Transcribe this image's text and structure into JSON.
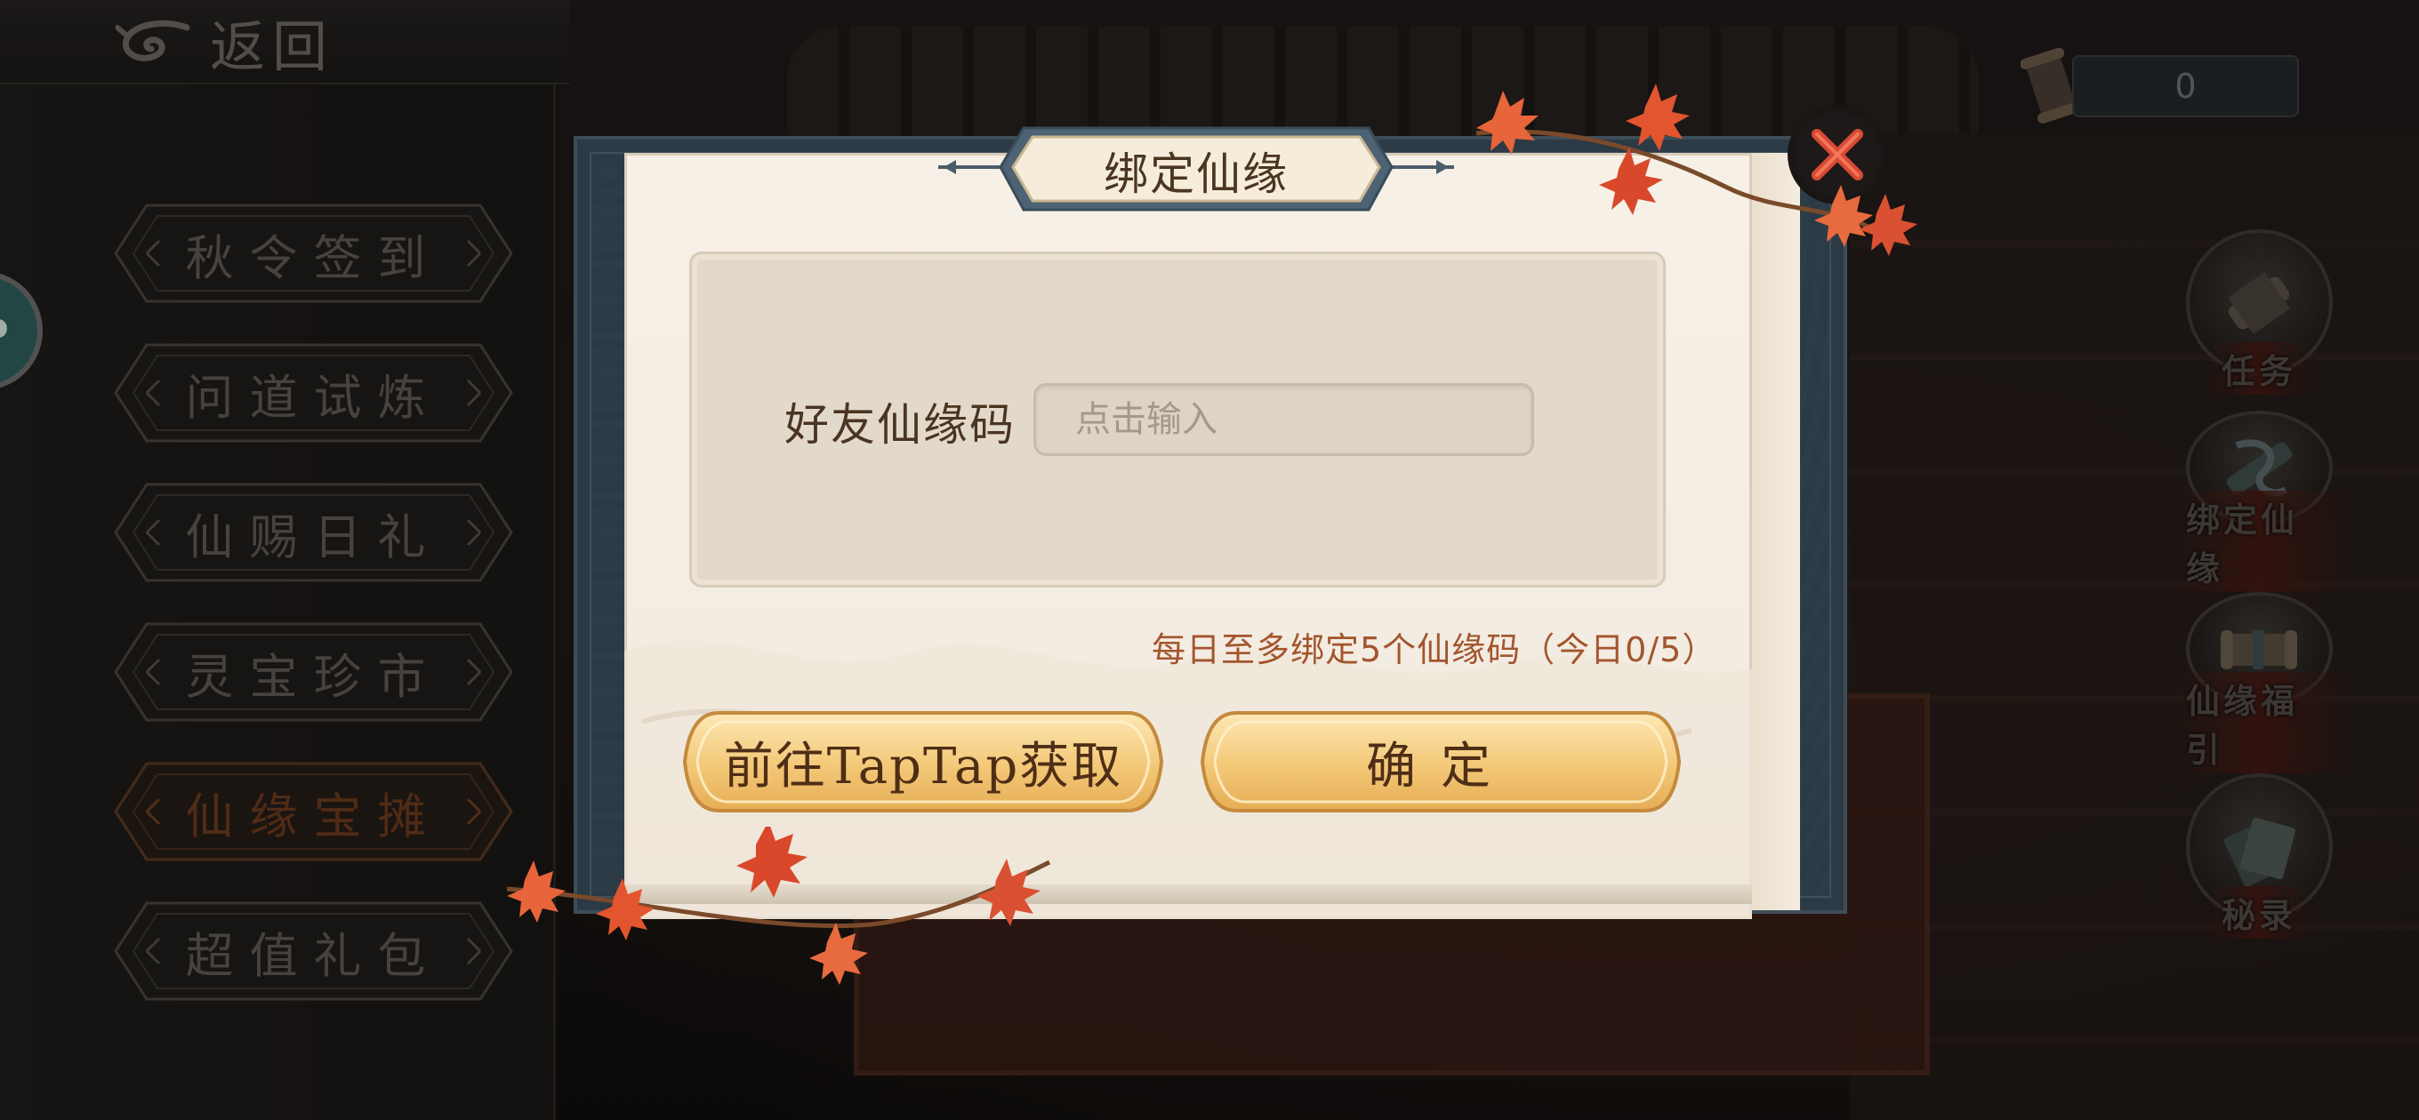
{
  "topbar": {
    "back_label": "返回"
  },
  "menu": {
    "items": [
      {
        "label": "秋令签到",
        "active": false
      },
      {
        "label": "问道试炼",
        "active": false
      },
      {
        "label": "仙赐日礼",
        "active": false
      },
      {
        "label": "灵宝珍市",
        "active": false
      },
      {
        "label": "仙缘宝摊",
        "active": true
      },
      {
        "label": "超值礼包",
        "active": false
      }
    ]
  },
  "side_token": {
    "label": "P"
  },
  "currency": {
    "value": "0"
  },
  "side_nav": {
    "items": [
      {
        "label": "任务",
        "icon": "scroll-task-icon"
      },
      {
        "label": "绑定仙缘",
        "icon": "bind-bond-icon"
      },
      {
        "label": "仙缘福引",
        "icon": "fortune-scroll-icon"
      },
      {
        "label": "秘录",
        "icon": "secret-record-icon"
      }
    ]
  },
  "dialog": {
    "title": "绑定仙缘",
    "field_label": "好友仙缘码",
    "input_placeholder": "点击输入",
    "input_value": "",
    "limit_note": "每日至多绑定5个仙缘码（今日0/5）",
    "taptap_button": "前往TapTap获取",
    "confirm_button": "确定"
  },
  "colors": {
    "accent_gold": "#f1c877",
    "close_red": "#d94a33",
    "note_orange": "#a3552d",
    "dialog_paper": "#f5efe5"
  }
}
